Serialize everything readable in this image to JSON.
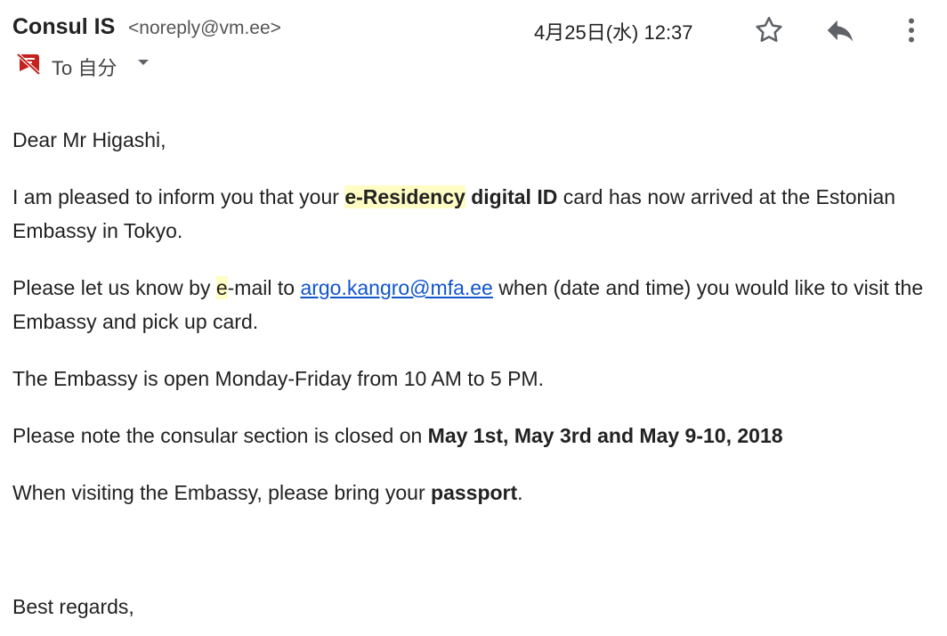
{
  "header": {
    "sender_name": "Consul IS",
    "sender_email": "<noreply@vm.ee>",
    "date": "4月25日(水) 12:37",
    "star_icon": "star-icon",
    "reply_icon": "reply-icon",
    "more_icon": "more-vert-icon"
  },
  "recipient": {
    "to_label": "To 自分",
    "notification_icon": "notifications-off-icon",
    "caret_icon": "caret-down-icon"
  },
  "body": {
    "greeting": "Dear Mr Higashi,",
    "p1": {
      "t1": " I am pleased to inform you that your ",
      "b1_hl": "e-Residency",
      "b1_rest": " digital ID",
      "t2": " card has now arrived at the Estonian Embassy in Tokyo."
    },
    "p2": {
      "t1": " Please let us know by ",
      "hl": "e",
      "t2": "-mail to ",
      "link": "argo.kangro@mfa.ee",
      "t3": "  when (date and time) you would like to visit the Embassy and pick up card."
    },
    "p3": " The Embassy is open Monday-Friday from 10 AM to 5 PM.",
    "p4": {
      "t1": "Please note the consular section is closed on ",
      "bold": "May 1st, May 3rd and May 9-10, 2018"
    },
    "p5": {
      "t1": "When visiting the Embassy, please bring your ",
      "bold": "passport",
      "t2": "."
    },
    "closing": "Best regards,"
  },
  "colors": {
    "highlight": "#fffcc4",
    "link": "#1155cc",
    "icon": "#5f6368",
    "notification_icon": "#c5221f"
  }
}
